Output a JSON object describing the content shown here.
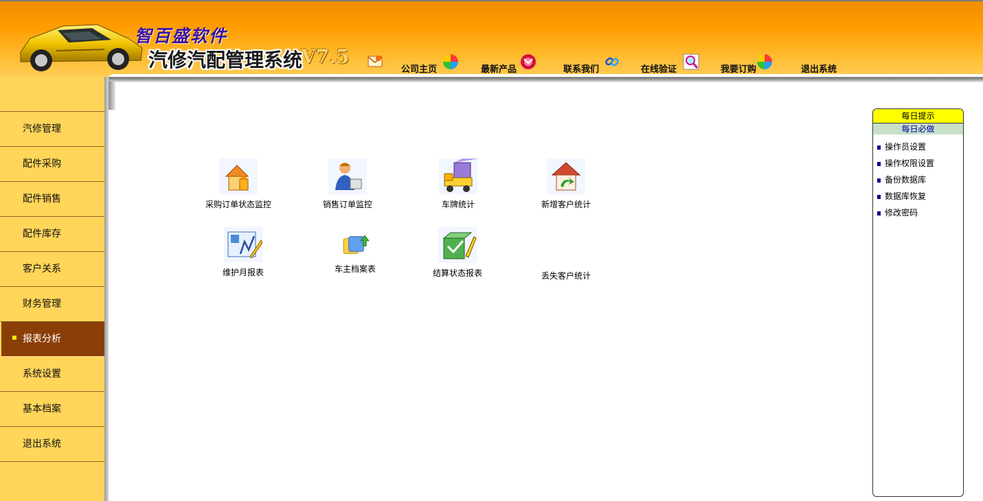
{
  "header": {
    "brand_name": "智百盛软件",
    "system_title": "汽修汽配管理系统",
    "version": "V7.5",
    "nav": [
      {
        "label": "公司主页",
        "icon": "pinwheel-icon"
      },
      {
        "label": "最新产品",
        "icon": "red-circle-icon"
      },
      {
        "label": "联系我们",
        "icon": "link-chain-icon"
      },
      {
        "label": "在线验证",
        "icon": "magnifier-icon"
      },
      {
        "label": "我要订购",
        "icon": "pinwheel-icon"
      },
      {
        "label": "退出系统",
        "icon": "mail-icon"
      }
    ]
  },
  "sidebar": {
    "active_index": 6,
    "items": [
      {
        "label": "汽修管理"
      },
      {
        "label": "配件采购"
      },
      {
        "label": "配件销售"
      },
      {
        "label": "配件库存"
      },
      {
        "label": "客户关系"
      },
      {
        "label": "财务管理"
      },
      {
        "label": "报表分析"
      },
      {
        "label": "系统设置"
      },
      {
        "label": "基本档案"
      },
      {
        "label": "退出系统"
      }
    ]
  },
  "reports": [
    {
      "label": "采购订单状态监控",
      "icon": "house-icon"
    },
    {
      "label": "销售订单监控",
      "icon": "salesperson-icon"
    },
    {
      "label": "车牌统计",
      "icon": "delivery-truck-icon"
    },
    {
      "label": "新增客户统计",
      "icon": "house-arrow-icon"
    },
    {
      "label": "维护月报表",
      "icon": "chart-pencil-icon"
    },
    {
      "label": "车主档案表",
      "icon": "folders-icon"
    },
    {
      "label": "结算状态报表",
      "icon": "package-check-icon"
    },
    {
      "label": "丢失客户统计",
      "icon": ""
    }
  ],
  "tips": {
    "title": "每日提示",
    "subtitle": "每日必做",
    "items": [
      {
        "label": "操作员设置"
      },
      {
        "label": "操作权限设置"
      },
      {
        "label": "备份数据库"
      },
      {
        "label": "数据库恢复"
      },
      {
        "label": "修改密码"
      }
    ]
  },
  "colors": {
    "header_orange": "#ff9d00",
    "sidebar_yellow": "#ffd55a",
    "active_menu": "#8b3f08",
    "tips_title_bg": "#ffff00",
    "tips_sub_bg": "#c8e0c8"
  }
}
